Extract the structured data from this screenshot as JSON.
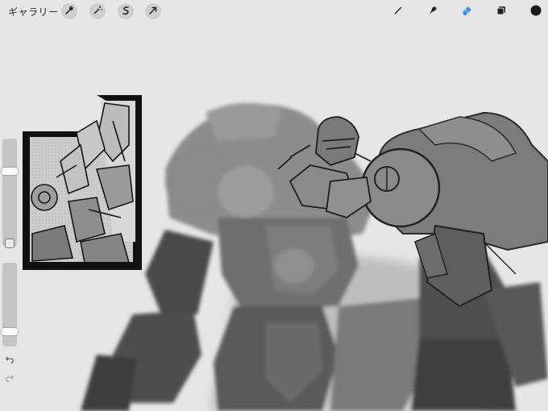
{
  "toolbar": {
    "gallery_label": "ギャラリー",
    "left_tools": [
      "wrench-icon",
      "magic-wand-icon",
      "selection-icon",
      "transform-arrow-icon"
    ],
    "right_tools": [
      "brush-icon",
      "smudge-icon",
      "eraser-icon",
      "layers-icon",
      "color-swatch"
    ],
    "active_tool": "eraser",
    "active_color": "#1a1a1a",
    "accent_color": "#3d8ee6"
  },
  "sidebar": {
    "brush_size_level": 0.71,
    "brush_opacity_level": 0.15,
    "controls": [
      "brush-size-slider",
      "modify-button",
      "brush-opacity-slider",
      "undo-icon",
      "redo-icon"
    ]
  }
}
